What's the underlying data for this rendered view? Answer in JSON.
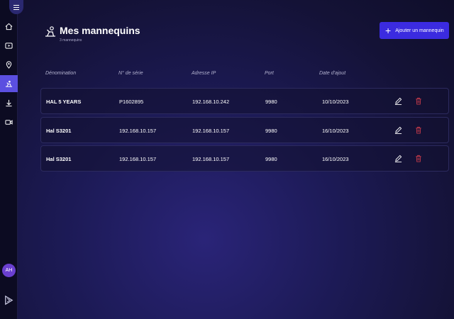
{
  "sidebar": {
    "items": [
      {
        "icon": "home-icon"
      },
      {
        "icon": "video-play-icon"
      },
      {
        "icon": "location-pin-icon"
      },
      {
        "icon": "mannequin-icon",
        "active": true
      },
      {
        "icon": "download-icon"
      },
      {
        "icon": "camera-icon"
      }
    ],
    "avatar": "AH"
  },
  "header": {
    "title": "Mes mannequins",
    "subtitle": "3 mannequins",
    "add_button_label": "Ajouter un mannequin"
  },
  "table": {
    "columns": [
      "Dénomination",
      "N° de série",
      "Adresse IP",
      "Port",
      "Date d'ajout"
    ],
    "rows": [
      {
        "name": "HAL 5 YEARS",
        "serial": "P1602895",
        "ip": "192.168.10.242",
        "port": "9980",
        "date": "10/10/2023"
      },
      {
        "name": "Hal S3201",
        "serial": "192.168.10.157",
        "ip": "192.168.10.157",
        "port": "9980",
        "date": "16/10/2023"
      },
      {
        "name": "Hal S3201",
        "serial": "192.168.10.157",
        "ip": "192.168.10.157",
        "port": "9980",
        "date": "16/10/2023"
      }
    ]
  },
  "colors": {
    "accent": "#3b2be0",
    "active_nav": "#5b4fe0",
    "delete": "#c0394a"
  }
}
